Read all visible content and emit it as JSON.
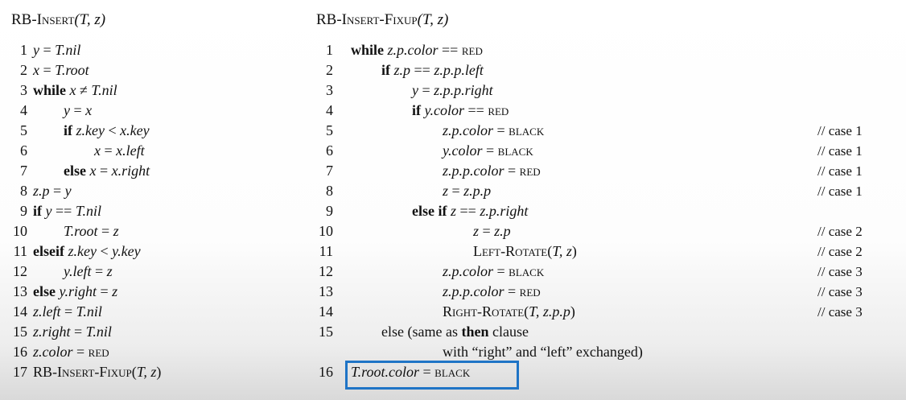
{
  "left": {
    "title_name": "RB-Insert",
    "title_args": "(T, z)",
    "lines": [
      {
        "n": "1",
        "parts": [
          {
            "t": "y",
            "s": "it"
          },
          {
            "t": " = ",
            "s": ""
          },
          {
            "t": "T.nil",
            "s": "it"
          }
        ]
      },
      {
        "n": "2",
        "parts": [
          {
            "t": "x",
            "s": "it"
          },
          {
            "t": " = ",
            "s": ""
          },
          {
            "t": "T.root",
            "s": "it"
          }
        ]
      },
      {
        "n": "3",
        "parts": [
          {
            "t": "while ",
            "s": "b"
          },
          {
            "t": "x",
            "s": "it"
          },
          {
            "t": " ≠ ",
            "s": ""
          },
          {
            "t": "T.nil",
            "s": "it"
          }
        ]
      },
      {
        "n": "4",
        "indent": 1,
        "parts": [
          {
            "t": "y",
            "s": "it"
          },
          {
            "t": " = ",
            "s": ""
          },
          {
            "t": "x",
            "s": "it"
          }
        ]
      },
      {
        "n": "5",
        "indent": 1,
        "parts": [
          {
            "t": "if ",
            "s": "b"
          },
          {
            "t": "z.key",
            "s": "it"
          },
          {
            "t": " < ",
            "s": ""
          },
          {
            "t": "x.key",
            "s": "it"
          }
        ]
      },
      {
        "n": "6",
        "indent": 2,
        "parts": [
          {
            "t": "x",
            "s": "it"
          },
          {
            "t": " = ",
            "s": ""
          },
          {
            "t": "x.left",
            "s": "it"
          }
        ]
      },
      {
        "n": "7",
        "indent": 1,
        "parts": [
          {
            "t": "else ",
            "s": "b"
          },
          {
            "t": "x",
            "s": "it"
          },
          {
            "t": " = ",
            "s": ""
          },
          {
            "t": "x.right",
            "s": "it"
          }
        ]
      },
      {
        "n": "8",
        "parts": [
          {
            "t": "z.p",
            "s": "it"
          },
          {
            "t": " = ",
            "s": ""
          },
          {
            "t": "y",
            "s": "it"
          }
        ]
      },
      {
        "n": "9",
        "parts": [
          {
            "t": "if ",
            "s": "b"
          },
          {
            "t": "y",
            "s": "it"
          },
          {
            "t": " == ",
            "s": ""
          },
          {
            "t": "T.nil",
            "s": "it"
          }
        ]
      },
      {
        "n": "10",
        "indent": 1,
        "parts": [
          {
            "t": "T.root",
            "s": "it"
          },
          {
            "t": " = ",
            "s": ""
          },
          {
            "t": "z",
            "s": "it"
          }
        ]
      },
      {
        "n": "11",
        "parts": [
          {
            "t": "elseif ",
            "s": "b"
          },
          {
            "t": "z.key",
            "s": "it"
          },
          {
            "t": " < ",
            "s": ""
          },
          {
            "t": "y.key",
            "s": "it"
          }
        ]
      },
      {
        "n": "12",
        "indent": 1,
        "parts": [
          {
            "t": "y.left",
            "s": "it"
          },
          {
            "t": " = ",
            "s": ""
          },
          {
            "t": "z",
            "s": "it"
          }
        ]
      },
      {
        "n": "13",
        "parts": [
          {
            "t": "else ",
            "s": "b"
          },
          {
            "t": "y.right",
            "s": "it"
          },
          {
            "t": " = ",
            "s": ""
          },
          {
            "t": "z",
            "s": "it"
          }
        ]
      },
      {
        "n": "14",
        "parts": [
          {
            "t": "z.left",
            "s": "it"
          },
          {
            "t": " = ",
            "s": ""
          },
          {
            "t": "T.nil",
            "s": "it"
          }
        ]
      },
      {
        "n": "15",
        "parts": [
          {
            "t": "z.right",
            "s": "it"
          },
          {
            "t": " = ",
            "s": ""
          },
          {
            "t": "T.nil",
            "s": "it"
          }
        ]
      },
      {
        "n": "16",
        "parts": [
          {
            "t": "z.color",
            "s": "it"
          },
          {
            "t": " = ",
            "s": ""
          },
          {
            "t": "red",
            "s": "sc"
          }
        ]
      },
      {
        "n": "17",
        "parts": [
          {
            "t": "RB-Insert-Fixup",
            "s": "sc"
          },
          {
            "t": "(",
            "s": ""
          },
          {
            "t": "T, z",
            "s": "it"
          },
          {
            "t": ")",
            "s": ""
          }
        ]
      }
    ]
  },
  "right": {
    "title_name": "RB-Insert-Fixup",
    "title_args": "(T, z)",
    "lines": [
      {
        "n": "1",
        "parts": [
          {
            "t": "while ",
            "s": "b"
          },
          {
            "t": "z.p.color",
            "s": "it"
          },
          {
            "t": " == ",
            "s": ""
          },
          {
            "t": "red",
            "s": "sc"
          }
        ]
      },
      {
        "n": "2",
        "indent": 1,
        "parts": [
          {
            "t": "if ",
            "s": "b"
          },
          {
            "t": "z.p",
            "s": "it"
          },
          {
            "t": " == ",
            "s": ""
          },
          {
            "t": "z.p.p.left",
            "s": "it"
          }
        ]
      },
      {
        "n": "3",
        "indent": 2,
        "parts": [
          {
            "t": "y",
            "s": "it"
          },
          {
            "t": " = ",
            "s": ""
          },
          {
            "t": "z.p.p.right",
            "s": "it"
          }
        ]
      },
      {
        "n": "4",
        "indent": 2,
        "parts": [
          {
            "t": "if ",
            "s": "b"
          },
          {
            "t": "y.color",
            "s": "it"
          },
          {
            "t": " == ",
            "s": ""
          },
          {
            "t": "red",
            "s": "sc"
          }
        ]
      },
      {
        "n": "5",
        "indent": 3,
        "parts": [
          {
            "t": "z.p.color",
            "s": "it"
          },
          {
            "t": " = ",
            "s": ""
          },
          {
            "t": "black",
            "s": "sc"
          }
        ],
        "comment": "// case 1"
      },
      {
        "n": "6",
        "indent": 3,
        "parts": [
          {
            "t": "y.color",
            "s": "it"
          },
          {
            "t": " = ",
            "s": ""
          },
          {
            "t": "black",
            "s": "sc"
          }
        ],
        "comment": "// case 1"
      },
      {
        "n": "7",
        "indent": 3,
        "parts": [
          {
            "t": "z.p.p.color",
            "s": "it"
          },
          {
            "t": " = ",
            "s": ""
          },
          {
            "t": "red",
            "s": "sc"
          }
        ],
        "comment": "// case 1"
      },
      {
        "n": "8",
        "indent": 3,
        "parts": [
          {
            "t": "z",
            "s": "it"
          },
          {
            "t": " = ",
            "s": ""
          },
          {
            "t": "z.p.p",
            "s": "it"
          }
        ],
        "comment": "// case 1"
      },
      {
        "n": "9",
        "indent": 2,
        "parts": [
          {
            "t": "else if ",
            "s": "b"
          },
          {
            "t": "z",
            "s": "it"
          },
          {
            "t": " == ",
            "s": ""
          },
          {
            "t": "z.p.right",
            "s": "it"
          }
        ]
      },
      {
        "n": "10",
        "indent": 4,
        "parts": [
          {
            "t": "z",
            "s": "it"
          },
          {
            "t": " = ",
            "s": ""
          },
          {
            "t": "z.p",
            "s": "it"
          }
        ],
        "comment": "// case 2"
      },
      {
        "n": "11",
        "indent": 4,
        "parts": [
          {
            "t": "Left-Rotate",
            "s": "sc"
          },
          {
            "t": "(",
            "s": ""
          },
          {
            "t": "T, z",
            "s": "it"
          },
          {
            "t": ")",
            "s": ""
          }
        ],
        "comment": "// case 2"
      },
      {
        "n": "12",
        "indent": 3,
        "parts": [
          {
            "t": "z.p.color",
            "s": "it"
          },
          {
            "t": " = ",
            "s": ""
          },
          {
            "t": "black",
            "s": "sc"
          }
        ],
        "comment": "// case 3"
      },
      {
        "n": "13",
        "indent": 3,
        "parts": [
          {
            "t": "z.p.p.color",
            "s": "it"
          },
          {
            "t": " = ",
            "s": ""
          },
          {
            "t": "red",
            "s": "sc"
          }
        ],
        "comment": "// case 3"
      },
      {
        "n": "14",
        "indent": 3,
        "parts": [
          {
            "t": "Right-Rotate",
            "s": "sc"
          },
          {
            "t": "(",
            "s": ""
          },
          {
            "t": "T, z.p.p",
            "s": "it"
          },
          {
            "t": ")",
            "s": ""
          }
        ],
        "comment": "// case 3"
      },
      {
        "n": "15",
        "indent": 1,
        "parts": [
          {
            "t": "else ",
            "s": ""
          },
          {
            "t": "(same as ",
            "s": ""
          },
          {
            "t": "then",
            "s": "b"
          },
          {
            "t": " clause",
            "s": ""
          }
        ]
      },
      {
        "n": "",
        "indent": 3,
        "parts": [
          {
            "t": "with “right” and “left” exchanged)",
            "s": ""
          }
        ]
      },
      {
        "n": "16",
        "parts": [
          {
            "t": "T.root.color",
            "s": "it"
          },
          {
            "t": " = ",
            "s": ""
          },
          {
            "t": "black",
            "s": "sc"
          }
        ],
        "highlight": true
      }
    ]
  },
  "colors": {
    "highlight_box": "#1f74c6"
  }
}
